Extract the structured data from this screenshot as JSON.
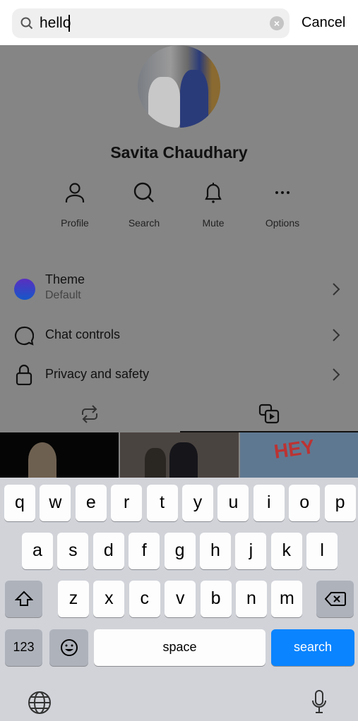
{
  "search": {
    "value": "hello",
    "cancel_label": "Cancel"
  },
  "profile": {
    "name": "Savita Chaudhary"
  },
  "actions": [
    {
      "label": "Profile",
      "icon": "person-icon"
    },
    {
      "label": "Search",
      "icon": "search-icon"
    },
    {
      "label": "Mute",
      "icon": "bell-icon"
    },
    {
      "label": "Options",
      "icon": "more-icon"
    }
  ],
  "settings": [
    {
      "title": "Theme",
      "subtitle": "Default",
      "icon": "theme-circle-icon"
    },
    {
      "title": "Chat controls",
      "icon": "chat-bubble-icon"
    },
    {
      "title": "Privacy and safety",
      "icon": "lock-icon"
    }
  ],
  "media_tabs": [
    {
      "icon": "repeat-icon"
    },
    {
      "icon": "media-icon"
    }
  ],
  "media_thumbs": [
    {
      "text": ""
    },
    {
      "text": ""
    },
    {
      "text": "HEY"
    }
  ],
  "keyboard": {
    "row1": [
      "q",
      "w",
      "e",
      "r",
      "t",
      "y",
      "u",
      "i",
      "o",
      "p"
    ],
    "row2": [
      "a",
      "s",
      "d",
      "f",
      "g",
      "h",
      "j",
      "k",
      "l"
    ],
    "row3": [
      "z",
      "x",
      "c",
      "v",
      "b",
      "n",
      "m"
    ],
    "numbers_label": "123",
    "space_label": "space",
    "search_label": "search"
  },
  "colors": {
    "accent": "#0a84ff",
    "theme_gradient": [
      "#5a2fc0",
      "#1657c8"
    ]
  }
}
